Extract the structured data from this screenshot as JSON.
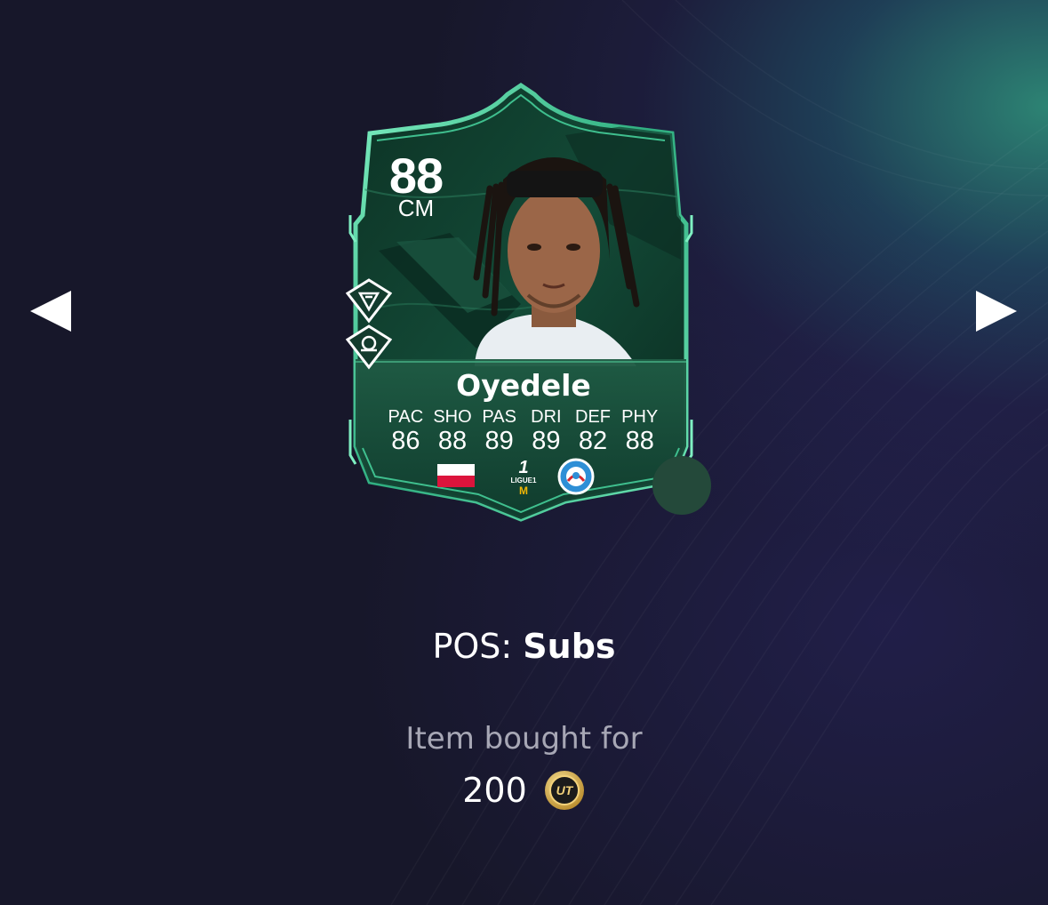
{
  "navigation": {
    "prev_icon": "triangle-left-icon",
    "next_icon": "triangle-right-icon"
  },
  "card": {
    "rating": "88",
    "position": "CM",
    "name": "Oyedele",
    "stats": [
      {
        "label": "PAC",
        "value": "86"
      },
      {
        "label": "SHO",
        "value": "88"
      },
      {
        "label": "PAS",
        "value": "89"
      },
      {
        "label": "DRI",
        "value": "89"
      },
      {
        "label": "DEF",
        "value": "82"
      },
      {
        "label": "PHY",
        "value": "88"
      }
    ],
    "nation_flag": {
      "top_color": "#ffffff",
      "bottom_color": "#dc143c"
    },
    "league_logo": {
      "mark": "1",
      "text": "LIGUE1",
      "sponsor": "M"
    },
    "club_badge_icon": "rc-strasbourg-badge-icon",
    "playstyle_icons": [
      "playstyle-plus-diamond-icon",
      "playstyle-diamond-icon"
    ],
    "accent_color": "#5ee3a8",
    "card_bg_color": "#0f3a2c"
  },
  "info": {
    "pos_label": "POS:",
    "pos_value": "Subs",
    "bought_label": "Item bought for",
    "price": "200",
    "coin_icon": "ut-coin-icon",
    "coin_text": "UT"
  }
}
